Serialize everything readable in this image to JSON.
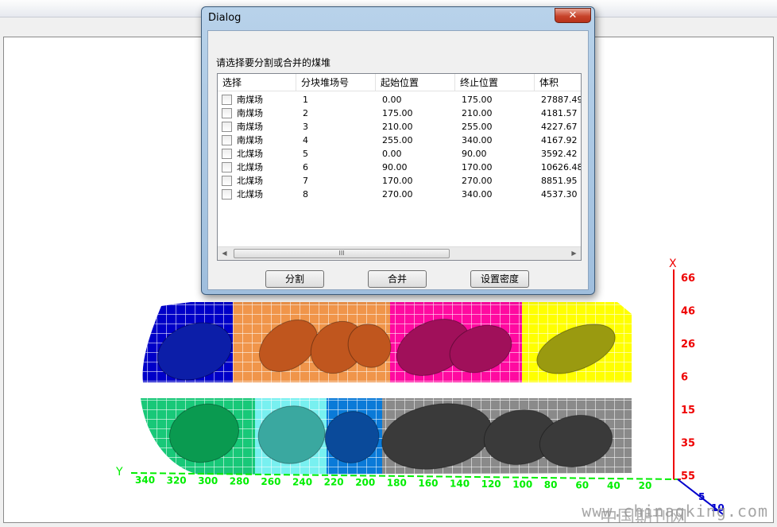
{
  "dialog": {
    "title": "Dialog",
    "close_glyph": "✕",
    "prompt": "请选择要分割或合并的煤堆",
    "columns": [
      "选择",
      "分块堆场号",
      "起始位置",
      "终止位置",
      "体积"
    ],
    "rows": [
      {
        "yard": "南煤场",
        "id": "1",
        "start": "0.00",
        "end": "175.00",
        "volume": "27887.49"
      },
      {
        "yard": "南煤场",
        "id": "2",
        "start": "175.00",
        "end": "210.00",
        "volume": "4181.57"
      },
      {
        "yard": "南煤场",
        "id": "3",
        "start": "210.00",
        "end": "255.00",
        "volume": "4227.67"
      },
      {
        "yard": "南煤场",
        "id": "4",
        "start": "255.00",
        "end": "340.00",
        "volume": "4167.92"
      },
      {
        "yard": "北煤场",
        "id": "5",
        "start": "0.00",
        "end": "90.00",
        "volume": "3592.42"
      },
      {
        "yard": "北煤场",
        "id": "6",
        "start": "90.00",
        "end": "170.00",
        "volume": "10626.48"
      },
      {
        "yard": "北煤场",
        "id": "7",
        "start": "170.00",
        "end": "270.00",
        "volume": "8851.95"
      },
      {
        "yard": "北煤场",
        "id": "8",
        "start": "270.00",
        "end": "340.00",
        "volume": "4537.30"
      }
    ],
    "scroll_left": "◀",
    "scroll_right": "▶",
    "scroll_grip": "III",
    "buttons": {
      "split": "分割",
      "merge": "合并",
      "density": "设置密度"
    }
  },
  "scene": {
    "axis_x": {
      "name": "X",
      "ticks": [
        "66",
        "46",
        "26",
        "6",
        "15",
        "35",
        "55"
      ],
      "color": "#ee0000"
    },
    "axis_y": {
      "name": "Y",
      "ticks": [
        "340",
        "320",
        "300",
        "280",
        "260",
        "240",
        "220",
        "200",
        "180",
        "160",
        "140",
        "120",
        "100",
        "80",
        "60",
        "40",
        "20"
      ],
      "color": "#00ee00"
    },
    "axis_z": {
      "ticks": [
        "5",
        "10"
      ],
      "color": "#0000cc"
    },
    "segment_colors": {
      "upper": [
        "#0000c8",
        "#f0954a",
        "#ff0aa0",
        "#ffff00"
      ],
      "lower": [
        "#18c878",
        "#78f0f0",
        "#0a7ad8",
        "#8a8a8a"
      ]
    },
    "pile_colors": {
      "upper": [
        "#0c1ea8",
        "#c0561e",
        "#a0105a",
        "#9a9a10"
      ],
      "lower": [
        "#0a9a50",
        "#3aa8a0",
        "#0a4a9a",
        "#3a3a3a"
      ]
    }
  },
  "watermark": {
    "text": "www.chinaqking.com",
    "text_cn": "中国期刊网"
  }
}
